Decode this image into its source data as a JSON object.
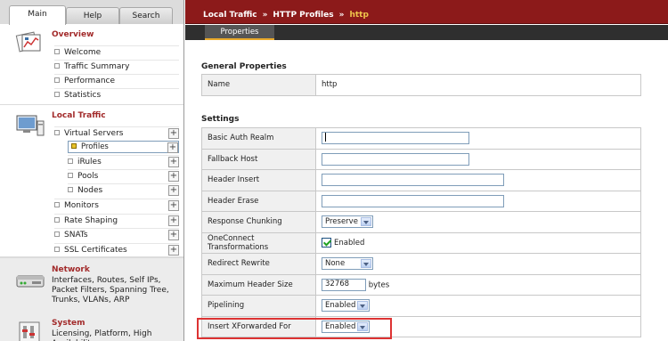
{
  "nav": {
    "tabs": [
      {
        "label": "Main",
        "active": true
      },
      {
        "label": "Help",
        "active": false
      },
      {
        "label": "Search",
        "active": false
      }
    ],
    "overview": {
      "title": "Overview",
      "items": [
        "Welcome",
        "Traffic Summary",
        "Performance",
        "Statistics"
      ]
    },
    "local_traffic": {
      "title": "Local Traffic",
      "items": [
        {
          "label": "Virtual Servers",
          "level": 0,
          "plus": true
        },
        {
          "label": "Profiles",
          "level": 1,
          "plus": true,
          "selected": true
        },
        {
          "label": "iRules",
          "level": 1,
          "plus": true
        },
        {
          "label": "Pools",
          "level": 1,
          "plus": true
        },
        {
          "label": "Nodes",
          "level": 1,
          "plus": true
        },
        {
          "label": "Monitors",
          "level": 0,
          "plus": true
        },
        {
          "label": "Rate Shaping",
          "level": 0,
          "plus": true
        },
        {
          "label": "SNATs",
          "level": 0,
          "plus": true
        },
        {
          "label": "SSL Certificates",
          "level": 0,
          "plus": true
        }
      ]
    },
    "network": {
      "title": "Network",
      "description": "Interfaces, Routes, Self IPs, Packet Filters, Spanning Tree, Trunks, VLANs, ARP"
    },
    "system": {
      "title": "System",
      "description": "Licensing, Platform, High Availability,"
    }
  },
  "breadcrumb": {
    "items": [
      "Local Traffic",
      "HTTP Profiles"
    ],
    "separator": "»",
    "current": "http"
  },
  "subtab": {
    "label": "Properties"
  },
  "general": {
    "title": "General Properties",
    "name_label": "Name",
    "name_value": "http"
  },
  "settings": {
    "title": "Settings",
    "rows": {
      "basic_auth_realm": {
        "label": "Basic Auth Realm",
        "value": ""
      },
      "fallback_host": {
        "label": "Fallback Host",
        "value": ""
      },
      "header_insert": {
        "label": "Header Insert",
        "value": ""
      },
      "header_erase": {
        "label": "Header Erase",
        "value": ""
      },
      "response_chunking": {
        "label": "Response Chunking",
        "value": "Preserve"
      },
      "oneconnect": {
        "label": "OneConnect Transformations",
        "checked": true,
        "checkbox_label": "Enabled"
      },
      "redirect_rewrite": {
        "label": "Redirect Rewrite",
        "value": "None"
      },
      "max_header_size": {
        "label": "Maximum Header Size",
        "value": "32768",
        "unit": "bytes"
      },
      "pipelining": {
        "label": "Pipelining",
        "value": "Enabled"
      },
      "xforwarded": {
        "label": "Insert XForwarded For",
        "value": "Enabled"
      }
    }
  },
  "colors": {
    "topbar": "#8c1a1a",
    "accent": "#e8a92b",
    "section_title": "#a22a2a",
    "highlight": "#dd3333"
  }
}
